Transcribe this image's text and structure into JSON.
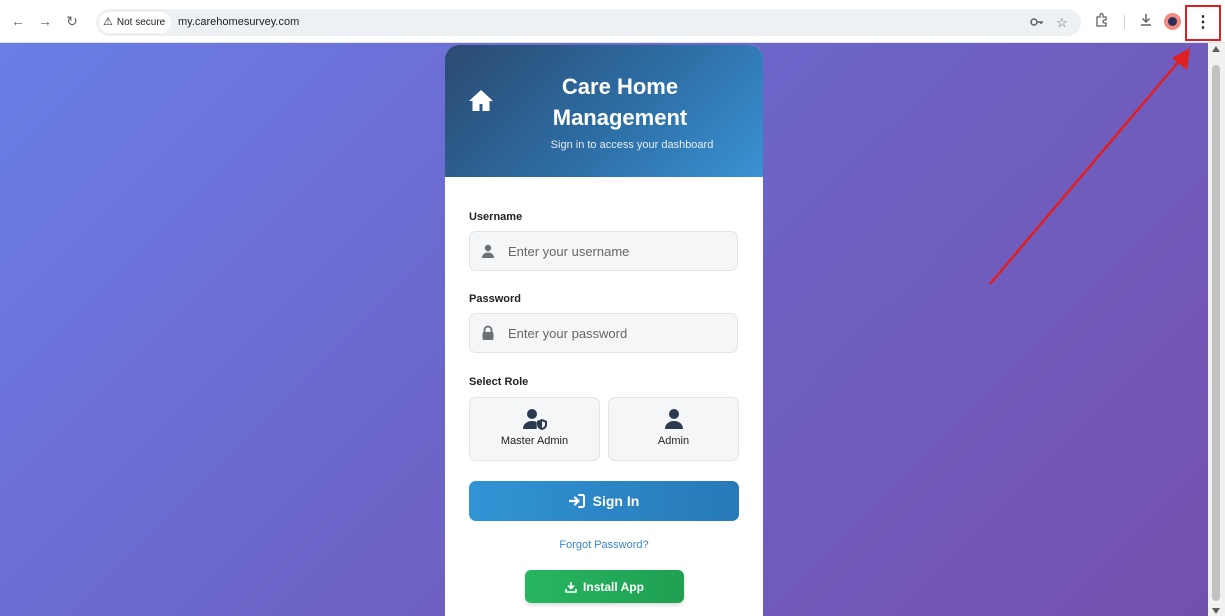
{
  "browser": {
    "url_host": "my.carehomesurvey.com",
    "security_label": "Not secure",
    "back_icon": "arrow-left-icon",
    "forward_icon": "arrow-right-icon",
    "reload_icon": "reload-icon",
    "menu_icon": "three-dots-vertical-icon"
  },
  "header": {
    "title": "Care Home Management",
    "subtitle": "Sign in to access your dashboard",
    "icon": "home-icon"
  },
  "form": {
    "username_label": "Username",
    "username_placeholder": "Enter your username",
    "password_label": "Password",
    "password_placeholder": "Enter your password",
    "role_label": "Select Role",
    "roles": [
      {
        "label": "Master Admin",
        "icon": "user-shield-icon"
      },
      {
        "label": "Admin",
        "icon": "user-icon"
      }
    ],
    "signin_label": "Sign In",
    "forgot_label": "Forgot Password?",
    "install_label": "Install App"
  },
  "colors": {
    "background_start": "#6a7ee8",
    "background_end": "#7450ad",
    "header_start": "#2c4a70",
    "header_end": "#3a92d4",
    "signin": "#2f8fd0",
    "install": "#22aa5a",
    "annotation": "#e02020"
  }
}
